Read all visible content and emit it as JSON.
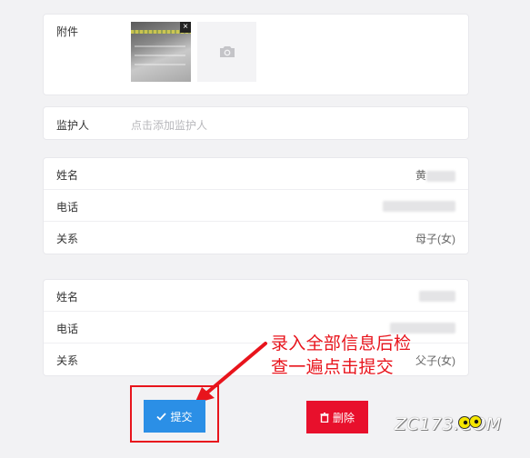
{
  "attachment": {
    "label": "附件",
    "close_glyph": "×",
    "upload_icon": "camera-icon"
  },
  "guardian": {
    "label": "监护人",
    "placeholder": "点击添加监护人"
  },
  "contacts": [
    {
      "name_label": "姓名",
      "name_value": "黄",
      "phone_label": "电话",
      "phone_value": "",
      "relation_label": "关系",
      "relation_value": "母子(女)"
    },
    {
      "name_label": "姓名",
      "name_value": "",
      "phone_label": "电话",
      "phone_value": "",
      "relation_label": "关系",
      "relation_value": "父子(女)"
    }
  ],
  "buttons": {
    "submit_label": "提交",
    "submit_icon": "check-icon",
    "delete_label": "删除",
    "delete_icon": "trash-icon",
    "submit_color": "#2b8fe6",
    "delete_color": "#e8102c"
  },
  "annotation": {
    "line1": "录入全部信息后检",
    "line2": "查一遍点击提交",
    "color": "#e8141c"
  },
  "watermark": {
    "text": "ZC173.COM"
  }
}
